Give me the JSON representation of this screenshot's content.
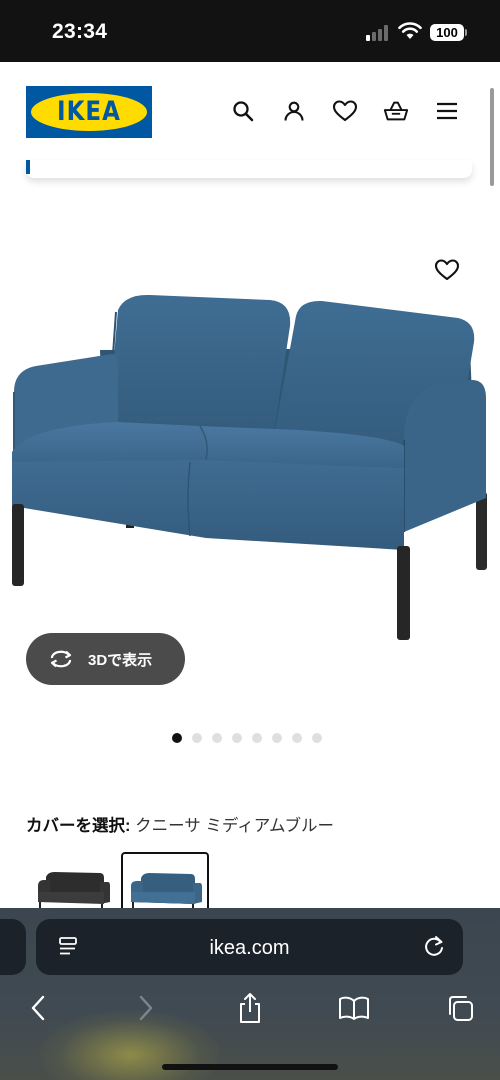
{
  "status_bar": {
    "time": "23:34",
    "battery": "100",
    "icons": [
      "signal-icon",
      "wifi-icon",
      "battery-icon"
    ]
  },
  "header": {
    "logo_text": "IKEA",
    "icons": [
      "search-icon",
      "account-icon",
      "favorites-icon",
      "cart-icon",
      "menu-icon"
    ]
  },
  "product": {
    "image_subject": "sofa",
    "fav_icon": "heart-icon",
    "view_3d_label": "3Dで表示",
    "carousel": {
      "total": 8,
      "active": 1
    },
    "cover_label": "カバーを選択:",
    "cover_value": "クニーサ ミディアムブルー",
    "swatches": [
      {
        "color": "#3c3c3c",
        "selected": false
      },
      {
        "color": "#3f6788",
        "selected": true
      }
    ]
  },
  "browser": {
    "url": "ikea.com",
    "toolbar_icons": [
      "back-icon",
      "forward-icon",
      "share-icon",
      "bookmarks-icon",
      "tabs-icon"
    ]
  },
  "colors": {
    "ikea_blue": "#0058a3",
    "ikea_yellow": "#ffdb00",
    "sofa_blue": "#3e6a8b"
  }
}
